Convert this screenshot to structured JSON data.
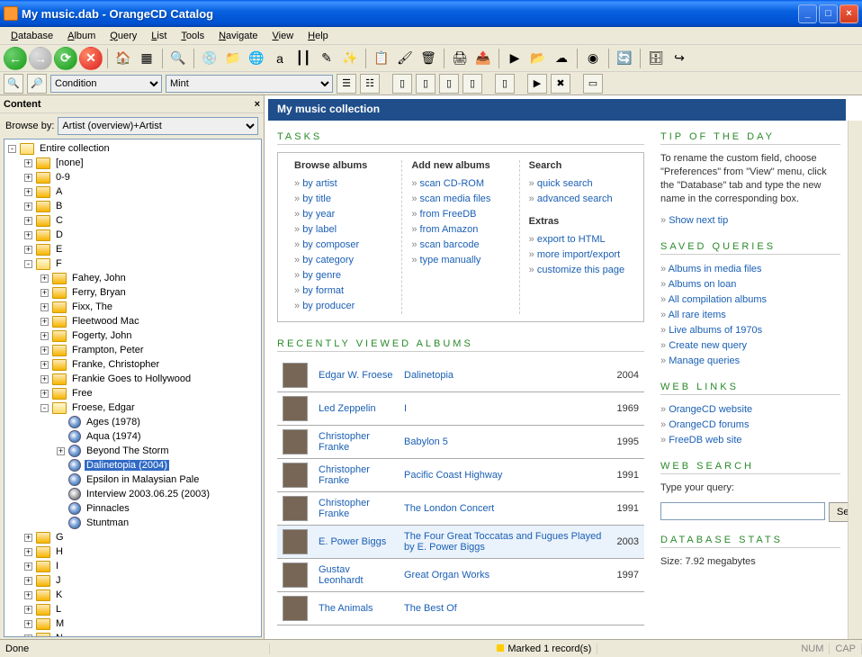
{
  "window": {
    "title": "My music.dab - OrangeCD Catalog"
  },
  "menu": [
    "Database",
    "Album",
    "Query",
    "List",
    "Tools",
    "Navigate",
    "View",
    "Help"
  ],
  "menu_accel": [
    "D",
    "A",
    "Q",
    "L",
    "T",
    "N",
    "V",
    "H"
  ],
  "toolbar2": {
    "combo1": "Condition",
    "combo2": "Mint"
  },
  "sidebar": {
    "title": "Content",
    "browse_label": "Browse by:",
    "browse_value": "Artist (overview)+Artist",
    "root": "Entire collection",
    "letters_before": [
      "[none]",
      "0-9",
      "A",
      "B",
      "C",
      "D",
      "E"
    ],
    "f_artists": [
      "Fahey, John",
      "Ferry, Bryan",
      "Fixx, The",
      "Fleetwood Mac",
      "Fogerty, John",
      "Frampton, Peter",
      "Franke, Christopher",
      "Frankie Goes to Hollywood",
      "Free"
    ],
    "froese": "Froese, Edgar",
    "froese_albums": [
      {
        "t": "Ages (1978)",
        "i": "disc"
      },
      {
        "t": "Aqua (1974)",
        "i": "disc"
      },
      {
        "t": "Beyond The Storm",
        "i": "disc",
        "exp": true
      },
      {
        "t": "Dalinetopia (2004)",
        "i": "disc",
        "sel": true
      },
      {
        "t": "Epsilon in Malaysian Pale",
        "i": "disc"
      },
      {
        "t": "Interview 2003.06.25 (2003)",
        "i": "alt"
      },
      {
        "t": "Pinnacles",
        "i": "disc"
      },
      {
        "t": "Stuntman",
        "i": "disc"
      }
    ],
    "letters_after": [
      "G",
      "H",
      "I",
      "J",
      "K",
      "L",
      "M",
      "N"
    ]
  },
  "content": {
    "header": "My music collection",
    "tasks_heading": "TASKS",
    "browse_h": "Browse albums",
    "browse": [
      "by artist",
      "by title",
      "by year",
      "by label",
      "by composer",
      "by category",
      "by genre",
      "by format",
      "by producer"
    ],
    "add_h": "Add new albums",
    "add": [
      "scan CD-ROM",
      "scan media files",
      "from FreeDB",
      "from Amazon",
      "scan barcode",
      "type manually"
    ],
    "search_h": "Search",
    "search": [
      "quick search",
      "advanced search"
    ],
    "extras_h": "Extras",
    "extras": [
      "export to HTML",
      "more import/export",
      "customize this page"
    ],
    "recent_h": "RECENTLY VIEWED ALBUMS",
    "recent": [
      {
        "artist": "Edgar W. Froese",
        "album": "Dalinetopia",
        "year": "2004"
      },
      {
        "artist": "Led Zeppelin",
        "album": "I",
        "year": "1969"
      },
      {
        "artist": "Christopher Franke",
        "album": "Babylon 5",
        "year": "1995"
      },
      {
        "artist": "Christopher Franke",
        "album": "Pacific Coast Highway",
        "year": "1991"
      },
      {
        "artist": "Christopher Franke",
        "album": "The London Concert",
        "year": "1991"
      },
      {
        "artist": "E. Power Biggs",
        "album": "The Four Great Toccatas and Fugues Played by E. Power Biggs",
        "year": "2003",
        "hl": true
      },
      {
        "artist": "Gustav Leonhardt",
        "album": "Great Organ Works",
        "year": "1997"
      },
      {
        "artist": "The Animals",
        "album": "The Best Of",
        "year": ""
      }
    ],
    "tip_h": "TIP OF THE DAY",
    "tip": "To rename the custom field, choose \"Preferences\" from \"View\" menu, click the \"Database\" tab and type the new name in the corresponding box.",
    "tip_next": "Show next tip",
    "saved_h": "SAVED QUERIES",
    "saved": [
      "Albums in media files",
      "Albums on loan",
      "All compilation albums",
      "All rare items",
      "Live albums of 1970s",
      "Create new query",
      "Manage queries"
    ],
    "weblinks_h": "WEB LINKS",
    "weblinks": [
      "OrangeCD website",
      "OrangeCD forums",
      "FreeDB web site"
    ],
    "websearch_h": "WEB SEARCH",
    "websearch_label": "Type your query:",
    "websearch_btn": "Search",
    "stats_h": "DATABASE STATS",
    "stats_size": "Size: 7.92 megabytes"
  },
  "status": {
    "done": "Done",
    "marked": "Marked 1 record(s)",
    "num": "NUM",
    "cap": "CAP"
  }
}
